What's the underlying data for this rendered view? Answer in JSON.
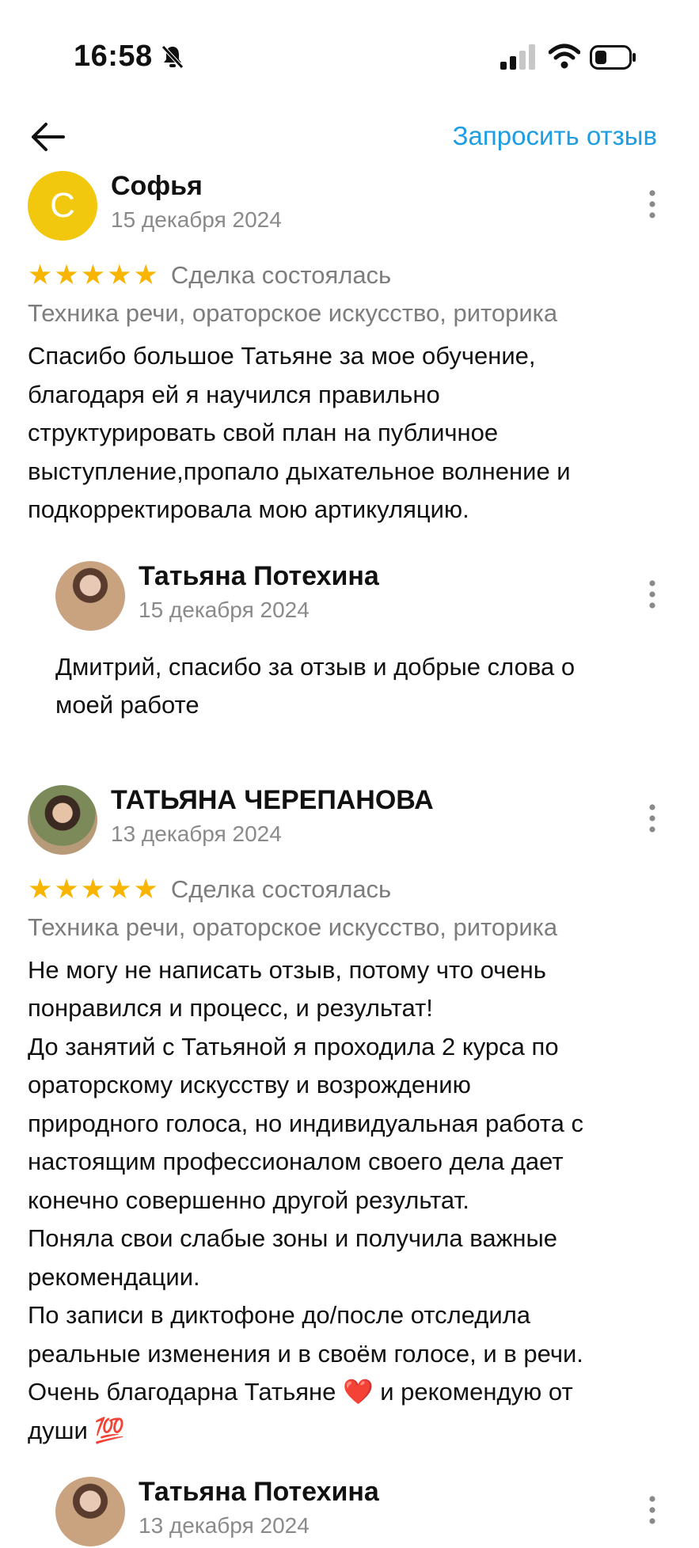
{
  "status_bar": {
    "time": "16:58"
  },
  "header": {
    "request_review": "Запросить отзыв"
  },
  "reviews": [
    {
      "avatar_letter": "С",
      "name": "Софья",
      "date": "15 декабря 2024",
      "stars": "★★★★★",
      "rating_value": 5,
      "deal_status": "Сделка состоялась",
      "topic": "Техника речи, ораторское искусство, риторика",
      "text": "Спасибо большое Татьяне за мое обучение,\nблагодаря ей я научился правильно\nструктурировать свой план на публичное\nвыступление,пропало дыхательное волнение и\nподкорректировала мою артикуляцию.",
      "reply": {
        "name": "Татьяна Потехина",
        "date": "15 декабря 2024",
        "text": "Дмитрий, спасибо за отзыв и добрые слова о\nмоей работе"
      }
    },
    {
      "name": "ТАТЬЯНА ЧЕРЕПАНОВА",
      "date": "13 декабря 2024",
      "stars": "★★★★★",
      "rating_value": 5,
      "deal_status": "Сделка состоялась",
      "topic": "Техника речи, ораторское искусство, риторика",
      "text": "Не могу не написать отзыв, потому что очень\nпонравился и процесс, и результат!\nДо занятий с Татьяной я проходила 2 курса по\nораторскому искусству и возрождению\nприродного голоса, но индивидуальная работа с\nнастоящим профессионалом своего дела дает\nконечно совершенно другой результат.\nПоняла свои слабые зоны и получила важные\nрекомендации.\nПо записи в диктофоне до/после отследила\nреальные изменения и в своём голосе, и в речи.\nОчень благодарна Татьяне ❤️ и рекомендую от\nдуши 💯",
      "reply": {
        "name": "Татьяна Потехина",
        "date": "13 декабря 2024"
      }
    }
  ]
}
